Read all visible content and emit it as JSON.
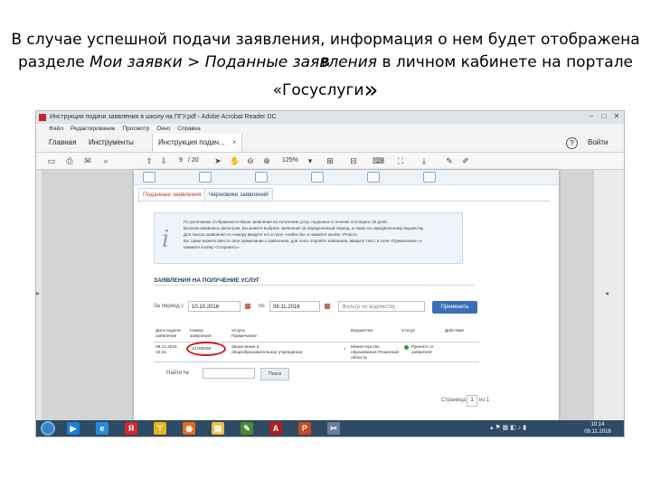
{
  "caption": {
    "line1": "В случае успешной подачи заявления, информация о нем будет отображена в",
    "line2_prefix": "разделе ",
    "line2_italic": "Мои заявки > Поданные заявления",
    "line2_suffix": " в личном кабинете на портале",
    "line3": "«Госуслуги",
    "line3_end": "»"
  },
  "window": {
    "title": "Инструкция подачи заявления в школу на ПГУ.pdf - Adobe Acrobat Reader DC",
    "menu": [
      "Файл",
      "Редактирование",
      "Просмотр",
      "Окно",
      "Справка"
    ],
    "tabs": [
      "Главная",
      "Инструменты",
      "Инструкция подач..."
    ],
    "close_tab": "×",
    "help": "?",
    "login": "Войти"
  },
  "toolbar": {
    "page_current": "9",
    "page_total": "/ 20",
    "zoom": "125%"
  },
  "portal": {
    "tabs": [
      "Поданные заявления",
      "Черновики заявлений"
    ],
    "info_glyph": "i",
    "info_lines": [
      "По умолчанию отображаются Ваши заявления на получение услуг, поданные в течение последних 30 дней.",
      "Воспользовавшись фильтром, Вы можете выбрать заявления за определенный период, а также по определенному ведомству.",
      "Для поиска заявления по номеру введите его в поле «Найти №» и нажмите кнопку «Поиск».",
      "Вы также можете ввести свое примечание к заявлению, для этого откройте заявление, введите текст в поле «Примечание» и",
      "нажмите кнопку «Сохранить»."
    ],
    "section_title": "ЗАЯВЛЕНИЯ НА ПОЛУЧЕНИЕ УСЛУГ",
    "period_label": "За период с",
    "date_from": "10.10.2016",
    "to_label": "по",
    "date_to": "08.11.2016",
    "dept_placeholder": "Фильтр по ведомству",
    "apply_button": "Применить",
    "columns": [
      "Дата подачи заявления",
      "Номер заявления",
      "Услуга Примечание",
      "Ведомство",
      "Статус",
      "Действие"
    ],
    "row": {
      "date": "08.11.2016 10:21",
      "number": "14780060",
      "service": "Зачисление в общеобразовательное учреждение",
      "department": "Министерство образования Рязанской области",
      "status": "Принято от заявителя"
    },
    "find_label": "Найти №",
    "find_button": "Поиск",
    "pager_label": "Страница",
    "pager_current": "1",
    "pager_total": "из 1"
  },
  "taskbar": {
    "clock_time": "10:14",
    "clock_date": "09.11.2016"
  },
  "colors": {
    "accent": "#3a6fb5",
    "highlight": "#d01a1a",
    "status_ok": "#2e9b3e"
  }
}
